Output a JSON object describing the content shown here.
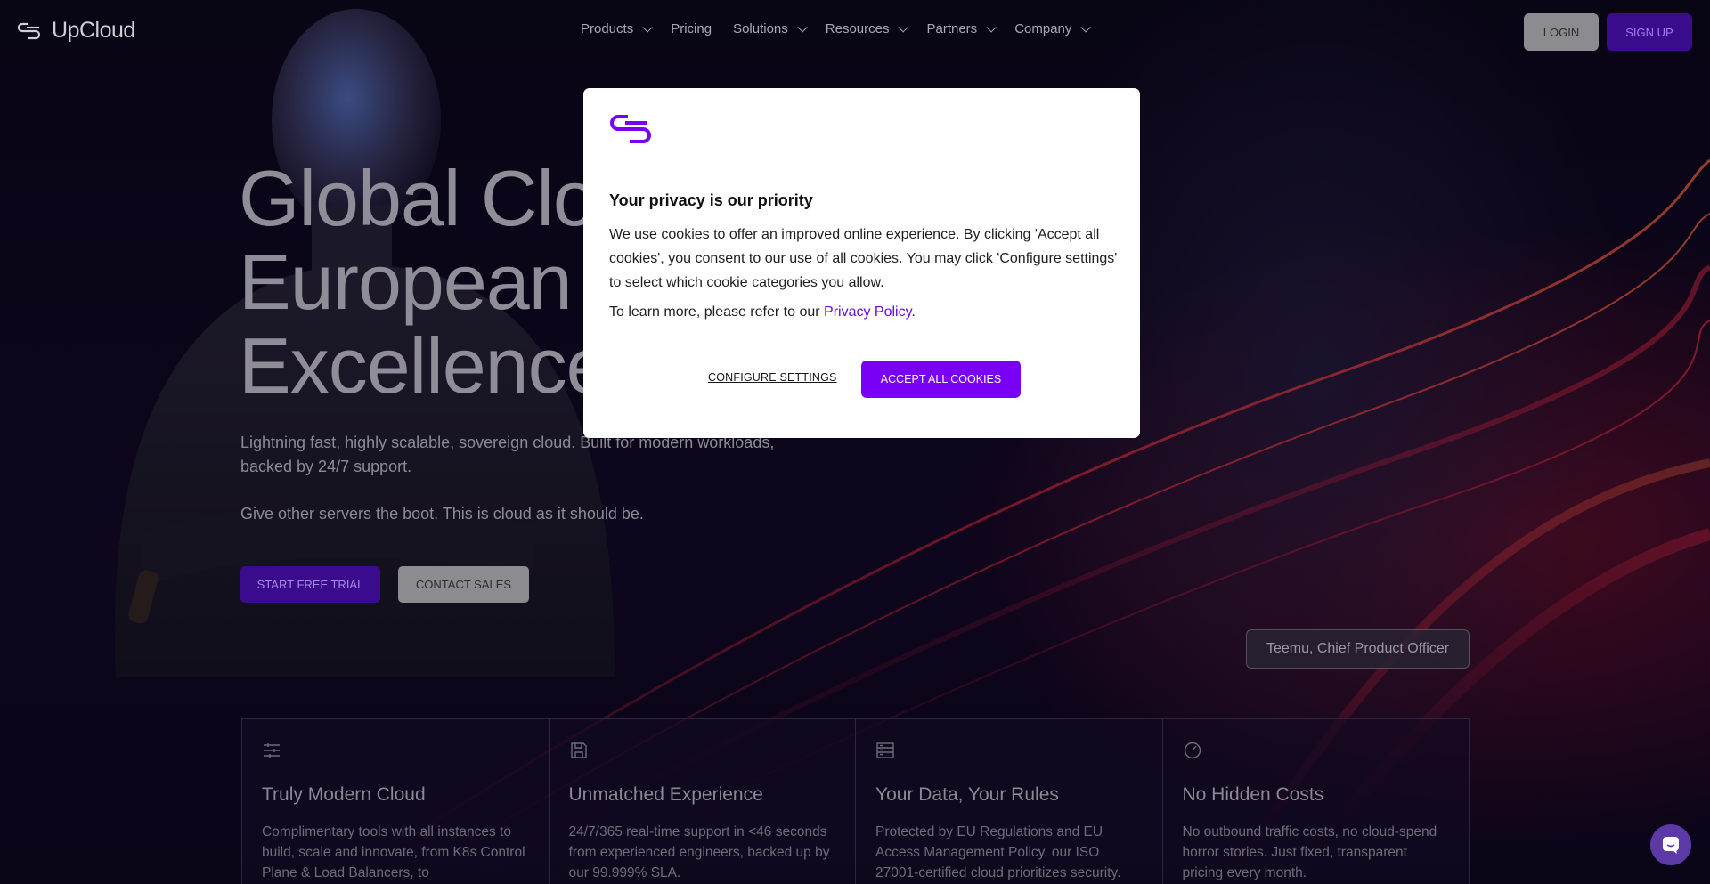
{
  "brand": {
    "name": "UpCloud",
    "accent": "#7a00f5"
  },
  "nav": {
    "items": [
      {
        "label": "Products",
        "dropdown": true
      },
      {
        "label": "Pricing",
        "dropdown": false
      },
      {
        "label": "Solutions",
        "dropdown": true
      },
      {
        "label": "Resources",
        "dropdown": true
      },
      {
        "label": "Partners",
        "dropdown": true
      },
      {
        "label": "Company",
        "dropdown": true
      }
    ],
    "login_label": "LOGIN",
    "signup_label": "SIGN UP"
  },
  "hero": {
    "title_lines": [
      "Global Clo",
      "European",
      "Excellence"
    ],
    "subtitle": "Lightning fast, highly scalable, sovereign cloud. Built for modern workloads, backed by 24/7 support.",
    "subtitle2": "Give other servers the boot. This is cloud as it should be.",
    "trial_label": "START FREE TRIAL",
    "contact_label": "CONTACT SALES",
    "caption": "Teemu, Chief Product Officer"
  },
  "features": [
    {
      "icon": "sliders-icon",
      "title": "Truly Modern Cloud",
      "desc": "Complimentary tools with all instances to build, scale and innovate, from K8s Control Plane & Load Balancers, to"
    },
    {
      "icon": "save-icon",
      "title": "Unmatched Experience",
      "desc": "24/7/365 real-time support in <46 seconds from experienced engineers, backed up by our 99.999% SLA."
    },
    {
      "icon": "server-icon",
      "title": "Your Data, Your Rules",
      "desc": "Protected by EU Regulations and EU Access Management Policy, our ISO 27001-certified cloud prioritizes security."
    },
    {
      "icon": "gauge-icon",
      "title": "No Hidden Costs",
      "desc": "No outbound traffic costs, no cloud-spend horror stories. Just fixed, transparent pricing every month."
    }
  ],
  "cookie_modal": {
    "title": "Your privacy is our priority",
    "body": "We use cookies to offer an improved online experience. By clicking 'Accept all cookies', you consent to our use of all cookies. You may click 'Configure settings' to select which cookie categories you allow.",
    "more_prefix": "To learn more, please refer to our ",
    "privacy_link": "Privacy Policy",
    "more_suffix": ".",
    "configure_label": "CONFIGURE SETTINGS",
    "accept_label": "ACCEPT ALL COOKIES"
  },
  "chat": {
    "icon": "chat-icon"
  }
}
